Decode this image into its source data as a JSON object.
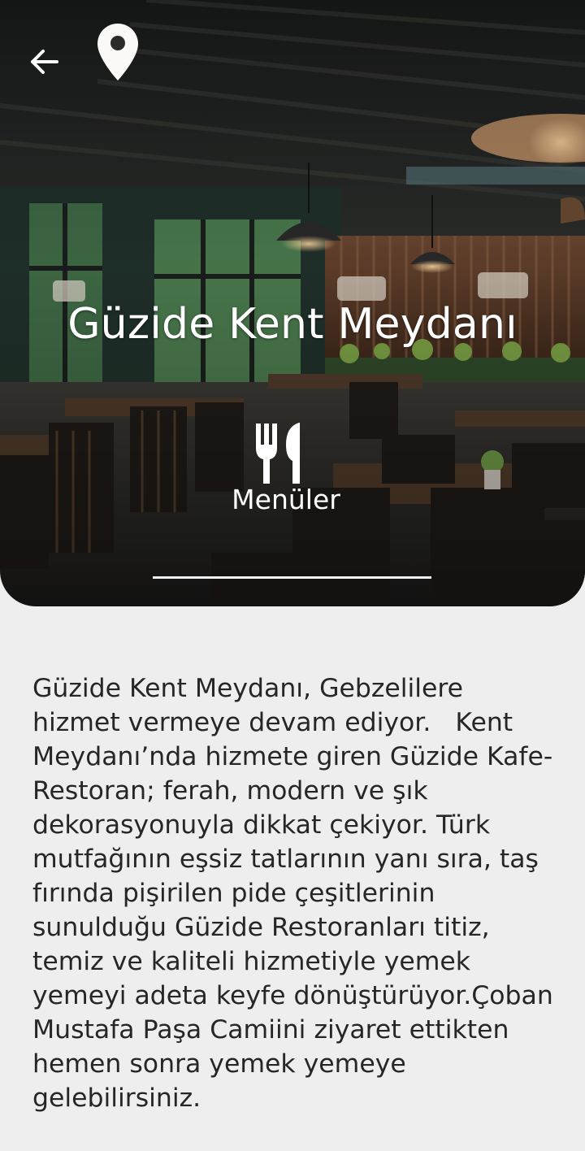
{
  "header": {
    "back_icon": "arrow-back-icon",
    "location_icon": "location-pin-icon",
    "title": "Güzide Kent Meydanı"
  },
  "menu": {
    "icon": "fork-knife-icon",
    "label": "Menüler"
  },
  "description": "Güzide Kent Meydanı, Gebzelilere\nhizmet vermeye devam ediyor.   Kent\nMeydanı’nda hizmete giren Güzide Kafe-\nRestoran; ferah, modern ve şık\ndekorasyonuyla dikkat çekiyor. Türk\nmutfağının eşsiz tatlarının yanı sıra, taş\nfırında pişirilen pide çeşitlerinin\nsunulduğu Güzide Restoranları titiz,\ntemiz ve kaliteli hizmetiyle yemek\nyemeyi adeta keyfe dönüştürüyor.Çoban\nMustafa Paşa Camiini ziyaret ettikten\nhemen sonra yemek yemeye\ngelebilirsiniz.",
  "colors": {
    "background": "#eeeeee",
    "text": "#262626",
    "overlay_text": "#ffffff"
  }
}
